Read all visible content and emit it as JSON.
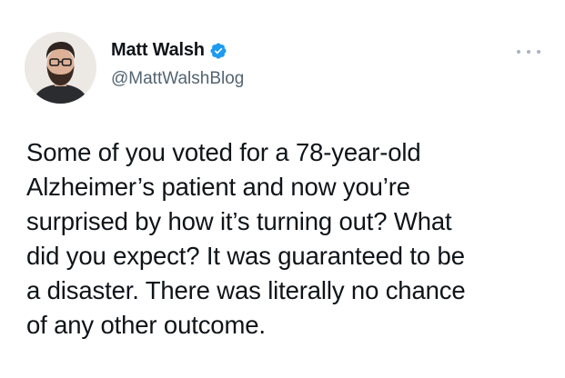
{
  "author": {
    "display_name": "Matt Walsh",
    "handle": "@MattWalshBlog",
    "verified": true,
    "verified_icon": "verified-badge-icon",
    "avatar_icon": "avatar-photo"
  },
  "menu": {
    "icon": "more-options-icon"
  },
  "tweet": {
    "lines": [
      "Some of you voted for a 78-year-old",
      "Alzheimer’s patient and now you’re",
      "surprised by how it’s turning out? What",
      "did you expect? It was guaranteed to be",
      "a disaster. There was literally no chance",
      "of any other outcome."
    ]
  },
  "colors": {
    "text": "#0f1419",
    "secondary_text": "#536471",
    "verified_blue": "#1d9bf0",
    "background": "#ffffff"
  }
}
